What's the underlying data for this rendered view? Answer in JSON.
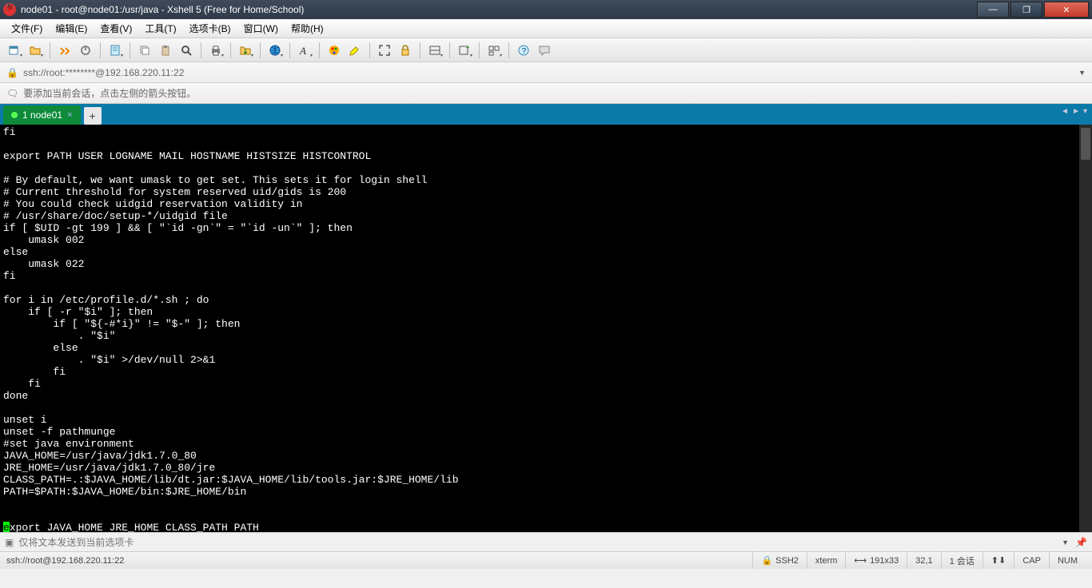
{
  "window": {
    "title": "node01 - root@node01:/usr/java - Xshell 5 (Free for Home/School)"
  },
  "menu": {
    "file": "文件(F)",
    "edit": "编辑(E)",
    "view": "查看(V)",
    "tools": "工具(T)",
    "tabs": "选项卡(B)",
    "window": "窗口(W)",
    "help": "帮助(H)"
  },
  "address": "ssh://root:********@192.168.220.11:22",
  "notify": "要添加当前会话，点击左侧的箭头按钮。",
  "tab": {
    "label": "1 node01",
    "close": "×"
  },
  "terminal_lines": [
    "fi",
    "",
    "export PATH USER LOGNAME MAIL HOSTNAME HISTSIZE HISTCONTROL",
    "",
    "# By default, we want umask to get set. This sets it for login shell",
    "# Current threshold for system reserved uid/gids is 200",
    "# You could check uidgid reservation validity in",
    "# /usr/share/doc/setup-*/uidgid file",
    "if [ $UID -gt 199 ] && [ \"`id -gn`\" = \"`id -un`\" ]; then",
    "    umask 002",
    "else",
    "    umask 022",
    "fi",
    "",
    "for i in /etc/profile.d/*.sh ; do",
    "    if [ -r \"$i\" ]; then",
    "        if [ \"${-#*i}\" != \"$-\" ]; then",
    "            . \"$i\"",
    "        else",
    "            . \"$i\" >/dev/null 2>&1",
    "        fi",
    "    fi",
    "done",
    "",
    "unset i",
    "unset -f pathmunge",
    "#set java environment",
    "JAVA_HOME=/usr/java/jdk1.7.0_80",
    "JRE_HOME=/usr/java/jdk1.7.0_80/jre",
    "CLASS_PATH=.:$JAVA_HOME/lib/dt.jar:$JAVA_HOME/lib/tools.jar:$JRE_HOME/lib",
    "PATH=$PATH:$JAVA_HOME/bin:$JRE_HOME/bin"
  ],
  "terminal_cursor_line_prefix": "e",
  "terminal_cursor_line_rest": "xport JAVA_HOME JRE_HOME CLASS_PATH PATH",
  "sendbar_placeholder": "仅将文本发送到当前选项卡",
  "status": {
    "conn": "ssh://root@192.168.220.11:22",
    "proto": "SSH2",
    "term": "xterm",
    "size": "191x33",
    "cursor": "32,1",
    "sessions": "1 会话",
    "cap": "CAP",
    "num": "NUM"
  },
  "icons": {
    "lock": "🔒",
    "arrow": "➜",
    "signal": "📶",
    "cmd": "▣"
  }
}
